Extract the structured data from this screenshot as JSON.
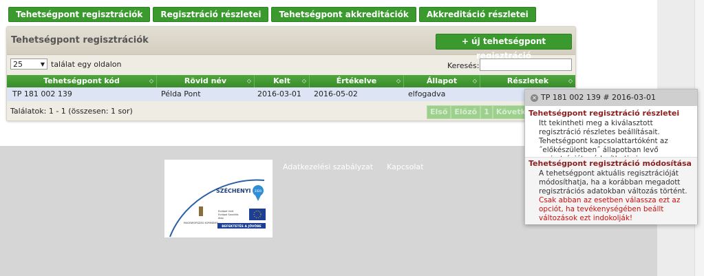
{
  "nav": {
    "tabs": [
      "Tehetségpont regisztrációk",
      "Regisztráció részletei",
      "Tehetségpont akkreditációk",
      "Akkreditáció részletei"
    ]
  },
  "panel": {
    "title": "Tehetségpont regisztrációk",
    "new_button": "+   új tehetségpont regisztráció"
  },
  "controls": {
    "per_page_value": "25",
    "per_page_label": "találat egy oldalon",
    "search_label": "Keresés:"
  },
  "table": {
    "columns": [
      "Tehetségpont kód",
      "Rövid név",
      "Kelt",
      "Értékelve",
      "Állapot",
      "Részletek"
    ],
    "rows": [
      [
        "TP 181 002 139",
        "Példa Pont",
        "2016-03-01",
        "2016-05-02",
        "elfogadva",
        ""
      ]
    ]
  },
  "footer_info": "Találatok: 1 - 1 (összesen: 1 sor)",
  "pager": [
    "Első",
    "Előző",
    "1",
    "Követke"
  ],
  "site_footer": {
    "links": [
      "Adatkezelési szabályzat",
      "Kapcsolat"
    ],
    "logo": {
      "brand": "SZÉCHENYI",
      "year": "2020",
      "gov": "MAGYARORSZÁG KORMÁNYA",
      "eu_line1": "Európai Unió",
      "eu_line2": "Európai Szociális",
      "eu_line3": "Alap",
      "slogan": "BEFEKTETÉS A JÖVŐBE"
    }
  },
  "popup": {
    "header": "TP 181 002 139 # 2016-03-01",
    "sec1_title": "Tehetségpont regisztráció részletei",
    "sec1_text": "Itt tekintheti meg a kiválasztott regisztráció részletes beállításait. Tehetségpont kapcsolattartóként az ˝előkészületben˝ állapotban levő regisztrációt módosíthatja is.",
    "sec2_title": "Tehetségpont regisztráció módosítása",
    "sec2_text": "A tehetségpont aktuális regisztrációját módosíthatja, ha a korábban megadott regisztrációs adatokban változás történt.",
    "sec2_warn": "Csak abban az esetben válassza ezt az opciót, ha tevékenységében beállt változások ezt indokolják!"
  },
  "colors": {
    "green": "#3a9a2e",
    "row": "#dde5f5",
    "footer": "#d6d6d6"
  }
}
